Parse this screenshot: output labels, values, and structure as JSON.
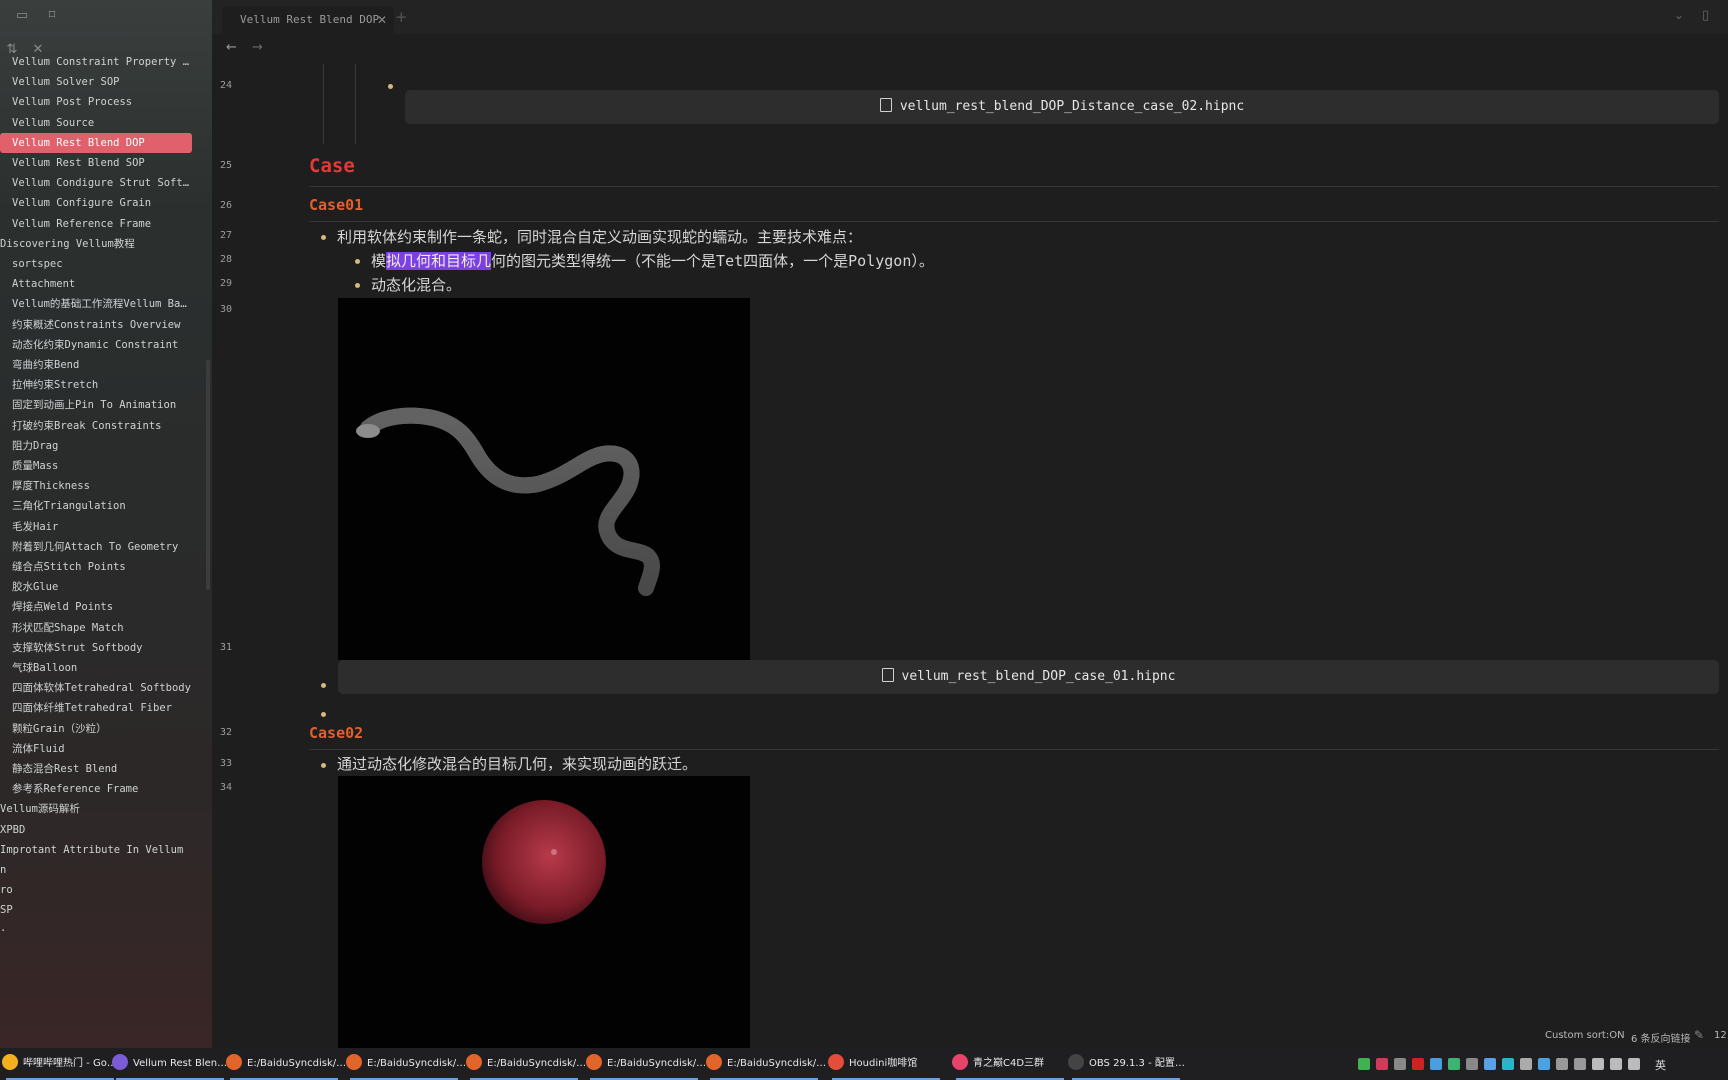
{
  "tab": {
    "title": "Vellum Rest Blend DOP",
    "close": "✕",
    "plus": "+"
  },
  "nav": {
    "back": "←",
    "forward": "→"
  },
  "sidebar": {
    "items": [
      {
        "label": "Vellum Constraint Property D…"
      },
      {
        "label": "Vellum Solver SOP"
      },
      {
        "label": "Vellum Post Process"
      },
      {
        "label": "Vellum Source"
      },
      {
        "label": "Vellum Rest Blend DOP",
        "active": true
      },
      {
        "label": "Vellum Rest Blend SOP"
      },
      {
        "label": "Vellum Condigure Strut Softb…"
      },
      {
        "label": "Vellum Configure Grain"
      },
      {
        "label": "Vellum Reference Frame"
      },
      {
        "label": "Discovering Vellum教程"
      },
      {
        "label": "sortspec"
      },
      {
        "label": "Attachment"
      },
      {
        "label": "Vellum的基础工作流程Vellum Ba…"
      },
      {
        "label": "约束概述Constraints Overview"
      },
      {
        "label": "动态化约束Dynamic Constraint"
      },
      {
        "label": "弯曲约束Bend"
      },
      {
        "label": "拉伸约束Stretch"
      },
      {
        "label": "固定到动画上Pin To Animation"
      },
      {
        "label": "打破约束Break Constraints"
      },
      {
        "label": "阻力Drag"
      },
      {
        "label": "质量Mass"
      },
      {
        "label": "厚度Thickness"
      },
      {
        "label": "三角化Triangulation"
      },
      {
        "label": "毛发Hair"
      },
      {
        "label": "附着到几何Attach To Geometry"
      },
      {
        "label": "缝合点Stitch Points"
      },
      {
        "label": "胶水Glue"
      },
      {
        "label": "焊接点Weld Points"
      },
      {
        "label": "形状匹配Shape Match"
      },
      {
        "label": "支撑软体Strut Softbody"
      },
      {
        "label": "气球Balloon"
      },
      {
        "label": "四面体软体Tetrahedral Softbody"
      },
      {
        "label": "四面体纤维Tetrahedral Fiber"
      },
      {
        "label": "颗粒Grain（沙粒）"
      },
      {
        "label": "流体Fluid"
      },
      {
        "label": "静态混合Rest Blend"
      },
      {
        "label": "参考系Reference Frame"
      },
      {
        "label": "Vellum源码解析"
      },
      {
        "label": "XPBD"
      },
      {
        "label": "Improtant Attribute In Vellum"
      },
      {
        "label": "n"
      },
      {
        "label": "ro"
      },
      {
        "label": "SP"
      },
      {
        "label": "·"
      }
    ]
  },
  "doc": {
    "line_numbers": [
      "24",
      "25",
      "26",
      "27",
      "28",
      "29",
      "30",
      "31",
      "32",
      "33",
      "34"
    ],
    "file1": "vellum_rest_blend_DOP_Distance_case_02.hipnc",
    "case_heading": "Case",
    "case01": {
      "title": "Case01",
      "bullet": "利用软体约束制作一条蛇，同时混合自定义动画实现蛇的蠕动。主要技术难点：",
      "sub1_pre": "模",
      "sub1_hl": "拟几何和目标几",
      "sub1_post": "何的图元类型得统一（不能一个是",
      "sub1_mono1": "Tet",
      "sub1_mid": "四面体，一个是",
      "sub1_mono2": "Polygon",
      "sub1_end": "）。",
      "sub2": "动态化混合。",
      "file": "vellum_rest_blend_DOP_case_01.hipnc"
    },
    "case02": {
      "title": "Case02",
      "bullet": "通过动态化修改混合的目标几何，来实现动画的跃迁。"
    }
  },
  "status": {
    "sort": "Custom sort:ON",
    "backlinks": "6 条反向链接",
    "words": "12"
  },
  "taskbar": [
    {
      "label": "哔哩哔哩热门 - Go…",
      "color": "#f2b01e"
    },
    {
      "label": "Vellum Rest Blen…",
      "color": "#7b5cd6"
    },
    {
      "label": "E:/BaiduSyncdisk/…",
      "color": "#e0652a"
    },
    {
      "label": "E:/BaiduSyncdisk/…",
      "color": "#e0652a"
    },
    {
      "label": "E:/BaiduSyncdisk/…",
      "color": "#e0652a"
    },
    {
      "label": "E:/BaiduSyncdisk/…",
      "color": "#e0652a"
    },
    {
      "label": "E:/BaiduSyncdisk/…",
      "color": "#e0652a"
    },
    {
      "label": "Houdini咖啡馆",
      "color": "#e34d3a"
    },
    {
      "label": "青之巅C4D三群",
      "color": "#e8446b"
    },
    {
      "label": "OBS 29.1.3 - 配置…",
      "color": "#444444"
    }
  ],
  "tray": {
    "lang": "英"
  },
  "colors": {
    "accent": "#e0606c",
    "heading": "#e53935",
    "subheading": "#e25f2f",
    "highlight": "#7b3fe4",
    "bullet": "#d9b77a"
  }
}
